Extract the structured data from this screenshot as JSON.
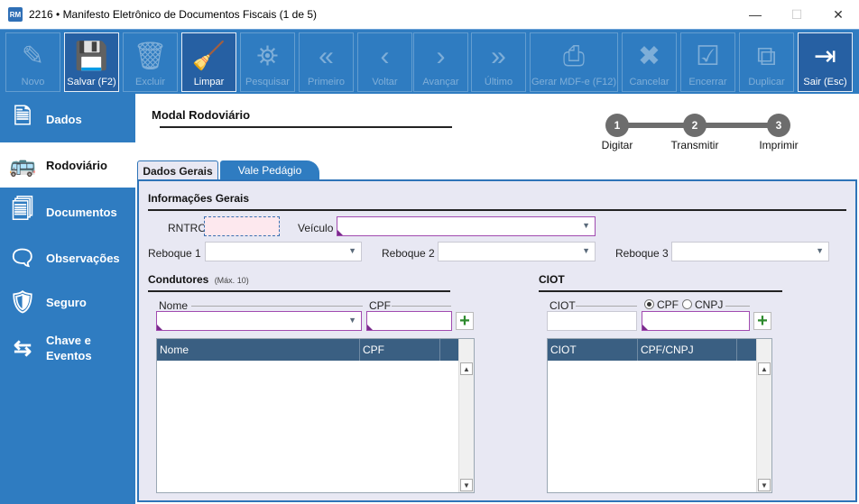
{
  "window": {
    "title": "2216 • Manifesto Eletrônico de Documentos Fiscais (1 de 5)",
    "app_icon": "RM",
    "controls": [
      "—",
      "☐",
      "✕"
    ]
  },
  "toolbar": [
    {
      "label": "Novo",
      "icon": "pencil-doc-icon",
      "glyph": "✎",
      "enabled": false
    },
    {
      "label": "Salvar (F2)",
      "icon": "floppy-disk-icon",
      "glyph": "💾",
      "enabled": true
    },
    {
      "label": "Excluir",
      "icon": "trash-icon",
      "glyph": "🗑",
      "enabled": false
    },
    {
      "label": "Limpar",
      "icon": "broom-icon",
      "glyph": "🧹",
      "enabled": true
    },
    {
      "label": "Pesquisar",
      "icon": "binoculars-icon",
      "glyph": "⛯",
      "enabled": false
    },
    {
      "label": "Primeiro",
      "icon": "double-chevron-left-icon",
      "glyph": "«",
      "enabled": false
    },
    {
      "label": "Voltar",
      "icon": "chevron-left-icon",
      "glyph": "‹",
      "enabled": false
    },
    {
      "label": "Avançar",
      "icon": "chevron-right-icon",
      "glyph": "›",
      "enabled": false
    },
    {
      "label": "Último",
      "icon": "double-chevron-right-icon",
      "glyph": "»",
      "enabled": false
    },
    {
      "label": "Gerar MDF-e (F12)",
      "icon": "printer-icon",
      "glyph": "⎙",
      "enabled": false
    },
    {
      "label": "Cancelar",
      "icon": "cancel-circle-icon",
      "glyph": "✖",
      "enabled": false
    },
    {
      "label": "Encerrar",
      "icon": "checklist-icon",
      "glyph": "☑",
      "enabled": false
    },
    {
      "label": "Duplicar",
      "icon": "duplicate-icon",
      "glyph": "⧉",
      "enabled": false
    },
    {
      "label": "Sair (Esc)",
      "icon": "exit-door-icon",
      "glyph": "⇥",
      "enabled": true
    }
  ],
  "sidebar": [
    {
      "label": "Dados",
      "icon": "document-icon",
      "glyph": "🗎",
      "active": false
    },
    {
      "label": "Rodoviário",
      "icon": "bus-icon",
      "glyph": "🚌",
      "active": true
    },
    {
      "label": "Documentos",
      "icon": "documents-add-icon",
      "glyph": "🗐",
      "active": false
    },
    {
      "label": "Observações",
      "icon": "speech-bubble-icon",
      "glyph": "🗨",
      "active": false
    },
    {
      "label": "Seguro",
      "icon": "shield-hands-icon",
      "glyph": "🛡",
      "active": false
    },
    {
      "label": "Chave e\nEventos",
      "icon": "arrows-exchange-icon",
      "glyph": "⇆",
      "active": false
    }
  ],
  "main": {
    "title": "Modal Rodoviário",
    "steps": [
      {
        "number": "1",
        "label": "Digitar"
      },
      {
        "number": "2",
        "label": "Transmitir"
      },
      {
        "number": "3",
        "label": "Imprimir"
      }
    ],
    "tabs": [
      "Dados Gerais",
      "Vale Pedágio"
    ],
    "info_title": "Informações Gerais",
    "fields": {
      "rntrc_label": "RNTRC",
      "rntrc_value": "",
      "veiculo_label": "Veículo",
      "veiculo_value": "",
      "reboque1_label": "Reboque 1",
      "reboque2_label": "Reboque 2",
      "reboque3_label": "Reboque 3"
    },
    "condutores": {
      "title": "Condutores",
      "note": "(Máx. 10)",
      "nome_label": "Nome",
      "cpf_label": "CPF",
      "columns": [
        "Nome",
        "CPF"
      ],
      "rows": []
    },
    "ciot": {
      "title": "CIOT",
      "ciot_label": "CIOT",
      "radio_cpf": "CPF",
      "radio_cnpj": "CNPJ",
      "selected": "CPF",
      "columns": [
        "CIOT",
        "CPF/CNPJ"
      ],
      "rows": []
    }
  },
  "colors": {
    "toolbar_bg": "#2f7cc1",
    "tab_panel_border": "#2e74b8",
    "grid_header": "#3a5f82",
    "required_marker": "#7a2a8c",
    "add_green": "#2d8a2d"
  }
}
